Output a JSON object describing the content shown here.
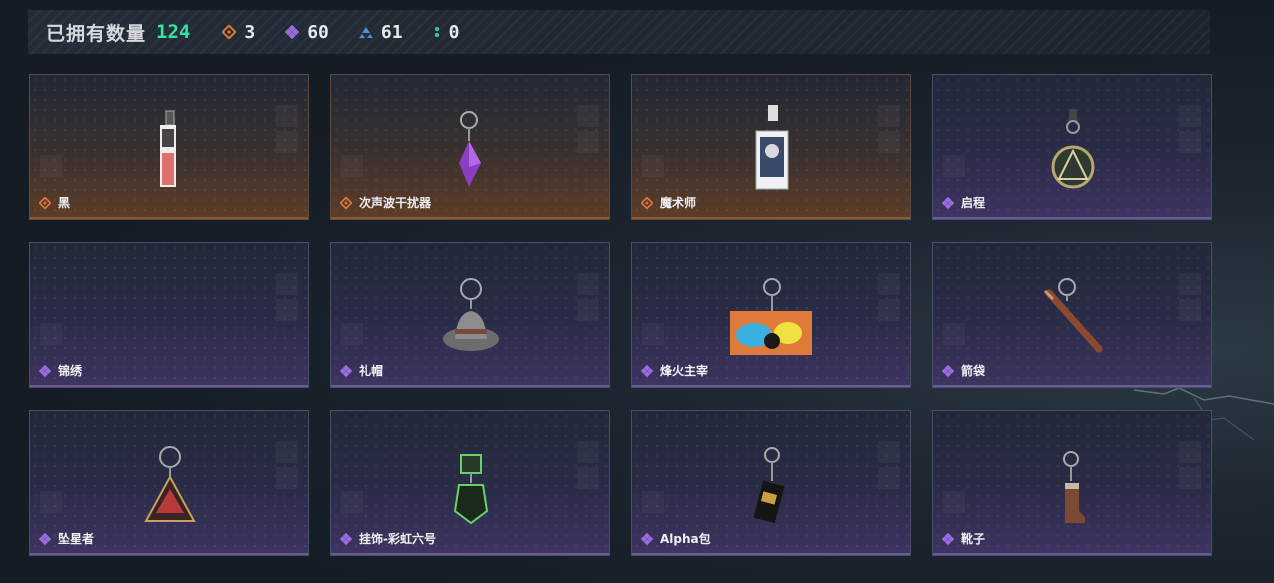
{
  "header": {
    "title": "已拥有数量",
    "count": "124",
    "stats": [
      {
        "icon": "orange-diamond-icon",
        "value": "3",
        "color": "#e0773a"
      },
      {
        "icon": "purple-diamond-icon",
        "value": "60",
        "color": "#9a6ee0"
      },
      {
        "icon": "blue-triangle-icon",
        "value": "61",
        "color": "#4d8fe0"
      },
      {
        "icon": "green-dots-icon",
        "value": "0",
        "color": "#33d48c"
      }
    ]
  },
  "colors": {
    "accent_green": "#33e3a0",
    "rarity_orange": "#e0773a",
    "rarity_purple": "#9a6ee0"
  },
  "items": [
    {
      "name": "黑",
      "rarity": "orange",
      "icon": "keycard-pendant-icon"
    },
    {
      "name": "次声波干扰器",
      "rarity": "orange",
      "icon": "purple-crystal-pendant-icon"
    },
    {
      "name": "魔术师",
      "rarity": "orange",
      "icon": "magician-card-pendant-icon"
    },
    {
      "name": "启程",
      "rarity": "purple",
      "icon": "medallion-pendant-icon"
    },
    {
      "name": "锦绣",
      "rarity": "purple",
      "icon": "empty-pendant-icon"
    },
    {
      "name": "礼帽",
      "rarity": "purple",
      "icon": "hat-pendant-icon"
    },
    {
      "name": "烽火主宰",
      "rarity": "purple",
      "icon": "graffiti-container-pendant-icon"
    },
    {
      "name": "箭袋",
      "rarity": "purple",
      "icon": "quiver-pendant-icon"
    },
    {
      "name": "坠星者",
      "rarity": "purple",
      "icon": "triangle-badge-pendant-icon"
    },
    {
      "name": "挂饰-彩虹六号",
      "rarity": "purple",
      "icon": "rainbow-six-pendant-icon"
    },
    {
      "name": "Alpha包",
      "rarity": "purple",
      "icon": "alpha-pack-pendant-icon"
    },
    {
      "name": "靴子",
      "rarity": "purple",
      "icon": "boot-pendant-icon"
    }
  ]
}
